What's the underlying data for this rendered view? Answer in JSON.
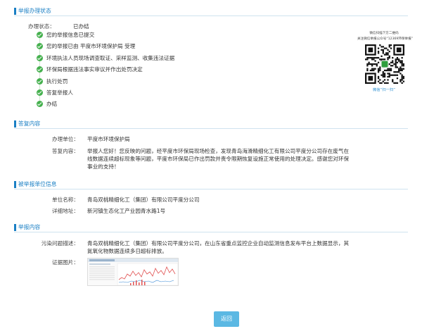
{
  "status_section": {
    "title": "举报办理状态",
    "status_label": "办理状态：",
    "status_value": "已办结",
    "steps": [
      "您的举报信息已提交",
      "您的举报已由 平度市环境保护局 受理",
      "环境执法人员现场调查取证、采样监测、收集违法证据",
      "环保局根据违法事实审议并作出处罚决定",
      "执行处罚",
      "答复举报人",
      "办结"
    ]
  },
  "qr": {
    "caption_line1": "微信扫描下方二维码",
    "caption_line2": "关注微信举报公众号“12369环保举报”",
    "footer": "微信“扫一扫”",
    "colors": {
      "dark": "#111111",
      "accent": "#2e9e3d"
    }
  },
  "reply_section": {
    "title": "答复内容",
    "unit_label": "办理单位：",
    "unit_value": "平度市环境保护局",
    "content_label": "答复内容：",
    "content_lines": [
      "举报人您好！您反映的问题，经平度市环保局现场检查，发现青岛海滑精细化工有限公司平度分公司存在废气在",
      "线数据连续超标现象等问题，平度市环保局已作出罚款并责令限期恢复设施正常使用的处理决定。感谢您对环保",
      "事业的支持！"
    ]
  },
  "reported_section": {
    "title": "被举报单位信息",
    "name_label": "单位名称：",
    "name_value": "青岛双桃精细化工（集团）有限公司平度分公司",
    "address_label": "详细地址：",
    "address_value": "新河镇生态化工产业园青水路1号"
  },
  "report_section": {
    "title": "举报内容",
    "desc_label": "污染问题描述：",
    "desc_lines": [
      "青岛双桃精细化工（集团）有限公司平度分公司，在山东省重点监控企业自动监测信息发布平台上数据显示，其",
      "氮氧化物数据连续多日超标排放。"
    ],
    "evidence_label": "证据图片："
  },
  "back_button": {
    "label": "返回"
  },
  "colors": {
    "accent": "#1a7fc4",
    "check": "#45b04e",
    "button": "#5bb8e3"
  }
}
